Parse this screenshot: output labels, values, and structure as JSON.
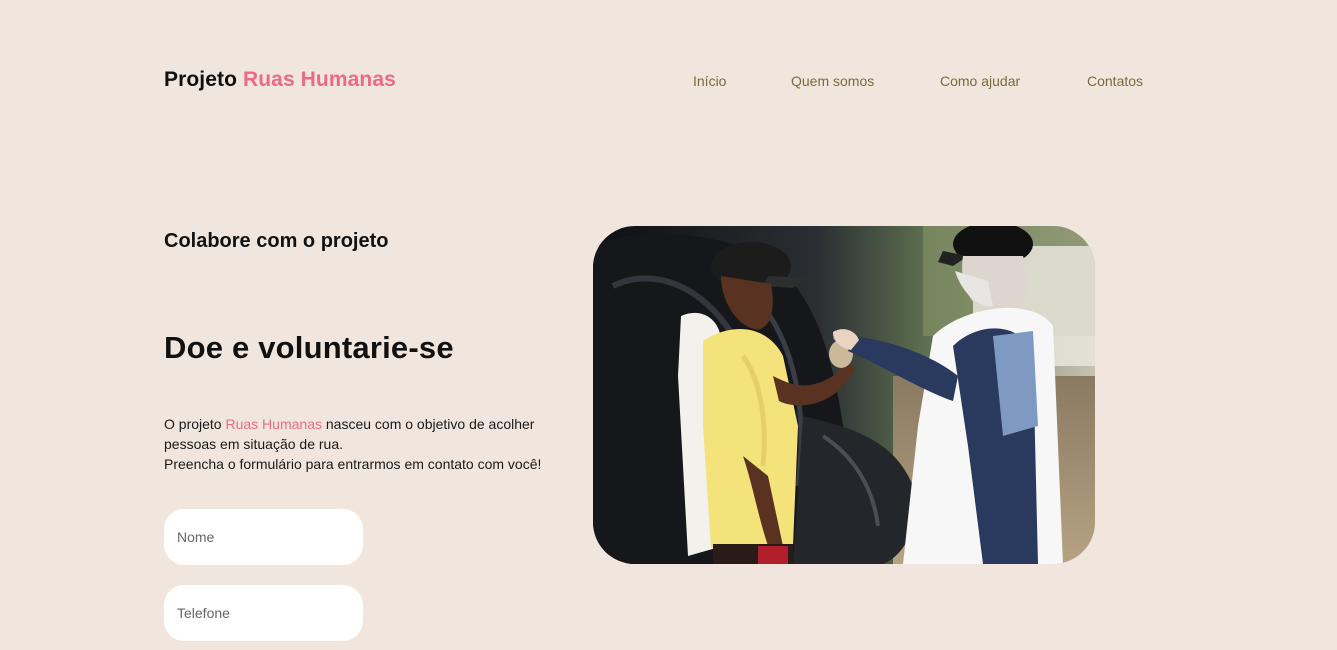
{
  "header": {
    "logo_prefix": "Projeto",
    "logo_accent": "Ruas Humanas"
  },
  "nav": {
    "items": [
      {
        "label": "Início"
      },
      {
        "label": "Quem somos"
      },
      {
        "label": "Como ajudar"
      },
      {
        "label": "Contatos"
      }
    ]
  },
  "hero": {
    "eyebrow": "Colabore com o projeto",
    "headline": "Doe e voluntarie-se",
    "intro_part1": "O projeto ",
    "intro_accent": "Ruas Humanas",
    "intro_part2": " nasceu com o objetivo de acolher pessoas em situação de rua.",
    "intro_line2": "Preencha o formulário para entrarmos em contato com você!"
  },
  "form": {
    "name_placeholder": "Nome",
    "phone_placeholder": "Telefone"
  },
  "colors": {
    "background": "#f0e6de",
    "accent": "#ec6a86",
    "nav_text": "#7a6b3a"
  }
}
